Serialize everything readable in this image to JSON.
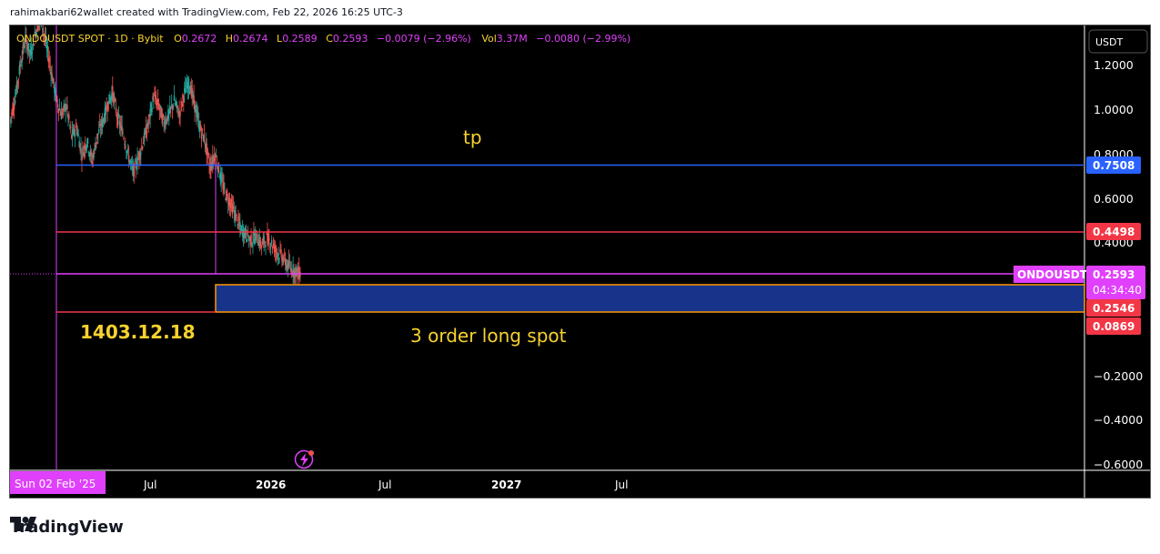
{
  "credit": "rahimakbari62wallet created with TradingView.com, Feb 22, 2026 16:25 UTC-3",
  "brand": "TradingView",
  "colors": {
    "candle_up": "#26a69a",
    "candle_down": "#ef5350",
    "tp_line": "#2962ff",
    "red_line": "#f23645",
    "magenta": "#e040fb",
    "zone_fill": "#18338a",
    "zone_border": "#ff9800",
    "annotation_text": "#f7d22e"
  },
  "chart_data": {
    "type": "candlestick",
    "symbol_line": {
      "symbol": "ONDOUSDT SPOT · 1D · Bybit",
      "o_label": "O",
      "o": "0.2672",
      "h_label": "H",
      "h": "0.2674",
      "l_label": "L",
      "l": "0.2589",
      "c_label": "C",
      "c": "0.2593",
      "change": "−0.0079 (−2.96%)",
      "vol_label": "Vol",
      "vol": "3.37M",
      "vol_change": "−0.0080 (−2.99%)"
    },
    "currency": "USDT",
    "y_ticks": [
      "1.2000",
      "1.0000",
      "0.8000",
      "0.6000",
      "0.4000",
      "−0.2000",
      "−0.4000",
      "−0.6000"
    ],
    "x_ticks": [
      "Jul",
      "2026",
      "Jul",
      "2027",
      "Jul"
    ],
    "crosshair_date": "Sun 02 Feb '25",
    "price_labels": {
      "tp": "0.7508",
      "red_upper": "0.4498",
      "symbol_tag": "ONDOUSDT",
      "last": "0.2593",
      "countdown": "04:34:40",
      "zone_top": "0.2546",
      "zone_bottom": "0.0869"
    },
    "levels": {
      "tp": 0.7508,
      "red_upper": 0.4498,
      "last": 0.2593,
      "zone_top": 0.2546,
      "zone_bottom": 0.0869
    },
    "annotations": {
      "tp": "tp",
      "date": "1403.12.18",
      "zone": "3 order long spot"
    },
    "price_path": [
      [
        0.0,
        0.95
      ],
      [
        0.6,
        1.05
      ],
      [
        1.2,
        1.2
      ],
      [
        1.8,
        1.32
      ],
      [
        2.4,
        1.25
      ],
      [
        3.0,
        1.35
      ],
      [
        3.6,
        1.42
      ],
      [
        4.2,
        1.3
      ],
      [
        4.8,
        1.18
      ],
      [
        5.4,
        1.05
      ],
      [
        6.0,
        0.98
      ],
      [
        6.6,
        1.02
      ],
      [
        7.2,
        0.88
      ],
      [
        7.8,
        0.92
      ],
      [
        8.4,
        0.8
      ],
      [
        9.0,
        0.86
      ],
      [
        9.6,
        0.77
      ],
      [
        10.2,
        0.88
      ],
      [
        10.8,
        0.94
      ],
      [
        11.4,
        1.02
      ],
      [
        12.0,
        1.08
      ],
      [
        12.6,
        0.96
      ],
      [
        13.2,
        0.9
      ],
      [
        13.8,
        0.8
      ],
      [
        14.4,
        0.72
      ],
      [
        15.0,
        0.78
      ],
      [
        15.6,
        0.86
      ],
      [
        16.2,
        0.94
      ],
      [
        16.8,
        1.06
      ],
      [
        17.4,
        1.02
      ],
      [
        18.0,
        0.94
      ],
      [
        18.6,
        0.98
      ],
      [
        19.2,
        1.04
      ],
      [
        19.8,
        0.98
      ],
      [
        20.4,
        1.08
      ],
      [
        21.0,
        1.12
      ],
      [
        21.6,
        1.02
      ],
      [
        22.2,
        0.92
      ],
      [
        22.8,
        0.86
      ],
      [
        23.4,
        0.74
      ],
      [
        24.0,
        0.8
      ],
      [
        24.6,
        0.7
      ],
      [
        25.2,
        0.62
      ],
      [
        25.8,
        0.58
      ],
      [
        26.4,
        0.52
      ],
      [
        27.0,
        0.46
      ],
      [
        27.6,
        0.44
      ],
      [
        28.2,
        0.41
      ],
      [
        28.8,
        0.43
      ],
      [
        29.4,
        0.39
      ],
      [
        30.0,
        0.42
      ],
      [
        30.6,
        0.4
      ],
      [
        31.2,
        0.36
      ],
      [
        31.8,
        0.34
      ],
      [
        32.4,
        0.3
      ],
      [
        33.0,
        0.28
      ],
      [
        33.6,
        0.27
      ],
      [
        34.0,
        0.26
      ]
    ]
  }
}
